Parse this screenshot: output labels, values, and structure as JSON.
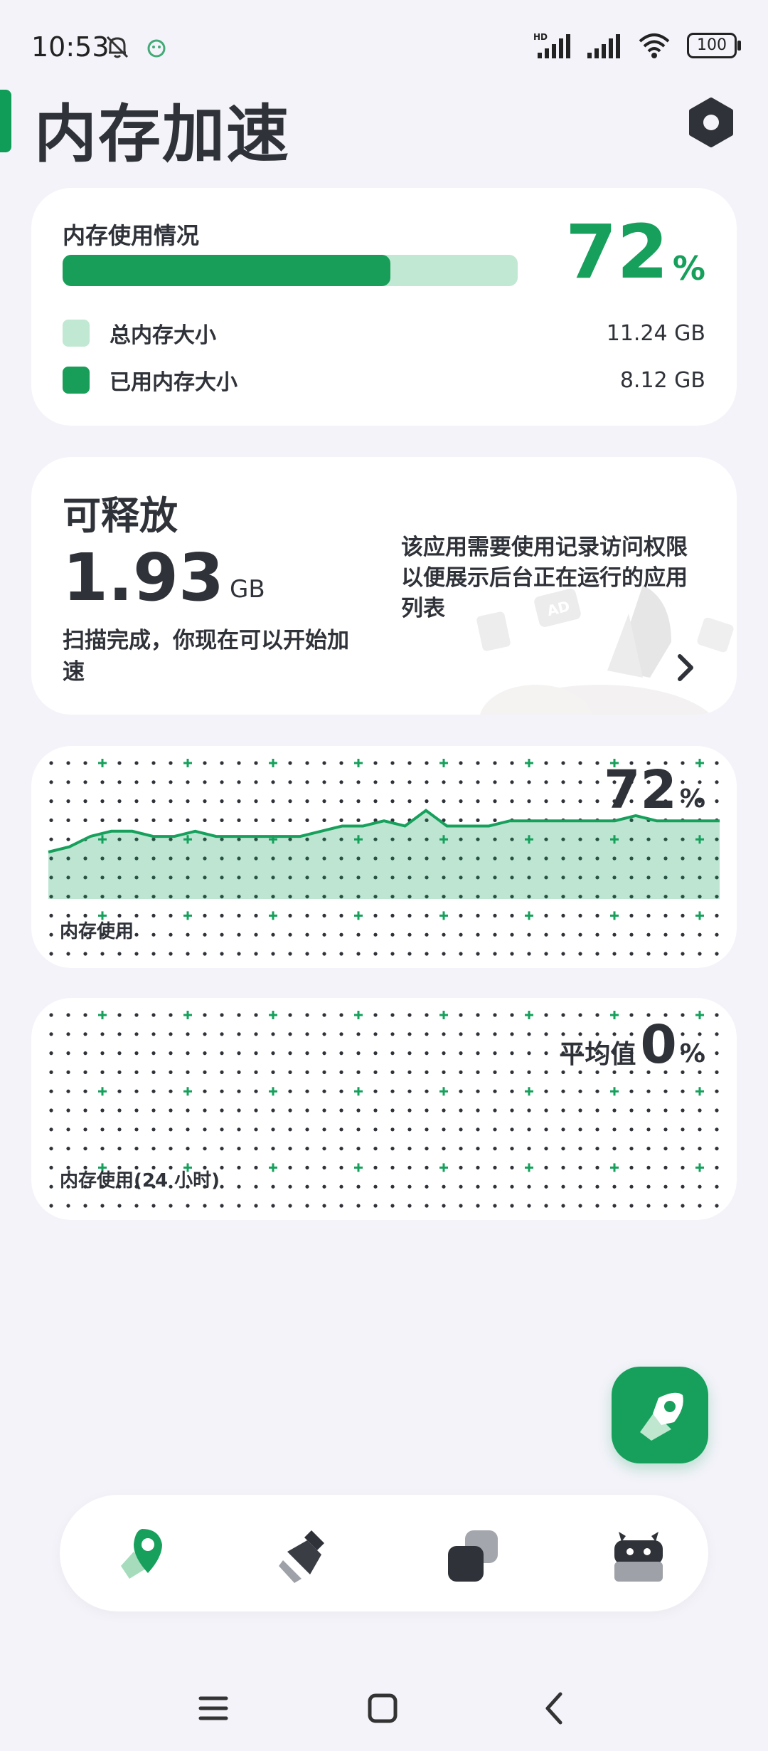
{
  "status_bar": {
    "time": "10:53",
    "network_label": "HD",
    "battery": "100",
    "icons": [
      "bell-off-icon",
      "app-notification-icon",
      "signal-icon",
      "signal-icon",
      "wifi-icon",
      "battery-icon"
    ]
  },
  "header": {
    "title": "内存加速",
    "settings_icon": "settings-hexagon-icon"
  },
  "memory_card": {
    "label": "内存使用情况",
    "percent_value": "72",
    "percent_sign": "%",
    "usage_fraction": 0.72,
    "legend": [
      {
        "label": "总内存大小",
        "value": "11.24 GB",
        "color": "#c1e8d2"
      },
      {
        "label": "已用内存大小",
        "value": "8.12 GB",
        "color": "#189e58"
      }
    ]
  },
  "release_card": {
    "title": "可释放",
    "amount": "1.93",
    "unit": "GB",
    "description": "扫描完成，你现在可以开始加速",
    "note": "该应用需要使用记录访问权限以便展示后台正在运行的应用列表",
    "art_badge": "AD"
  },
  "chart_data": [
    {
      "type": "area",
      "caption": "内存使用",
      "value": "72",
      "unit": "%",
      "title": "",
      "xlabel": "",
      "ylabel": "",
      "ylim": [
        0,
        100
      ],
      "grid": true,
      "series": [
        {
          "values": [
            70,
            71,
            73,
            74,
            74,
            73,
            73,
            74,
            73,
            73,
            73,
            73,
            73,
            74,
            75,
            75,
            76,
            75,
            78,
            75,
            75,
            75,
            76,
            76,
            76,
            76,
            76,
            76,
            77,
            76,
            76,
            76,
            76
          ]
        }
      ]
    },
    {
      "type": "area",
      "caption": "内存使用(24 小时)",
      "prefix": "平均值",
      "value": "0",
      "unit": "%",
      "title": "",
      "xlabel": "",
      "ylabel": "",
      "grid": true,
      "series": []
    }
  ],
  "fab": {
    "icon": "rocket-boost-icon"
  },
  "bottom_nav": {
    "items": [
      {
        "icon": "rocket-icon",
        "active": true
      },
      {
        "icon": "broom-icon",
        "active": false
      },
      {
        "icon": "apps-stack-icon",
        "active": false
      },
      {
        "icon": "android-icon",
        "active": false
      }
    ]
  },
  "colors": {
    "accent": "#16a05c",
    "accent_light": "#c1e8d2",
    "text": "#2f3238",
    "background": "#f3f3f9"
  }
}
